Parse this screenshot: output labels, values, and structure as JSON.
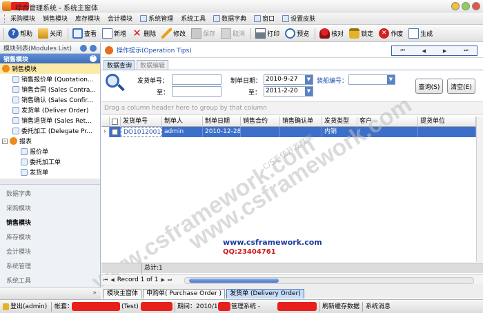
{
  "window": {
    "title": "综合管理系统 - 系统主窗体"
  },
  "menu": {
    "items": [
      {
        "label": "采购模块",
        "icon": "module-icon"
      },
      {
        "label": "销售模块",
        "icon": "module-icon"
      },
      {
        "label": "库存模块",
        "icon": "module-icon"
      },
      {
        "label": "会计模块",
        "icon": "module-icon"
      },
      {
        "label": "系统管理",
        "icon": "system-icon"
      },
      {
        "label": "系统工具",
        "icon": "tools-icon"
      },
      {
        "label": "数据字典",
        "icon": "dictionary-icon"
      },
      {
        "label": "窗口",
        "icon": "window-icon"
      },
      {
        "label": "设置皮肤",
        "icon": "skin-icon"
      }
    ]
  },
  "toolbar": {
    "help": "帮助",
    "close": "关闭",
    "view": "查看",
    "new": "新增",
    "delete": "删除",
    "edit": "修改",
    "save": "保存",
    "cancel": "取消",
    "print": "打印",
    "preview": "预览",
    "check": "核对",
    "lock": "锁定",
    "void": "作废",
    "generate": "生成"
  },
  "left_panel": {
    "header": "模块列表(Modules List)",
    "group_title": "销售模块",
    "tree": {
      "root": "销售模块",
      "items": [
        "销售报价单 (Quotation...",
        "销售合同 (Sales Contra...",
        "销售确认 (Sales Confir...",
        "发货单 (Deliver Order)",
        "销售退货单 (Sales Ret...",
        "委托加工 (Delegate Pr..."
      ],
      "report_group": "报表",
      "report_items": [
        "报价单",
        "委托加工单",
        "发货单"
      ]
    },
    "nav": {
      "items": [
        "数据字典",
        "采购模块",
        "销售模块",
        "库存模块",
        "会计模块",
        "系统管理",
        "系统工具"
      ],
      "active": "销售模块"
    },
    "bottom_arrow": "»"
  },
  "main": {
    "tips_label": "操作提示(Operation Tips)",
    "pager": {
      "first": "⏮",
      "prev": "◀",
      "next": "▶",
      "last": "⏭"
    },
    "tabs": {
      "query": "数据查询",
      "edit": "数据编辑"
    },
    "search": {
      "doc_no_label": "发货单号：",
      "to_label_1": "至：",
      "date_label": "制单日期：",
      "date_from": "2010-9-27",
      "to_label_2": "至：",
      "date_to": "2011-2-20",
      "ship_no_label": "装船编号：",
      "ship_no_value": "",
      "query_button": "查询(S)",
      "clear_button": "清空(E)"
    },
    "group_hint": "Drag a column header here to group by that column",
    "grid": {
      "columns": [
        "发货单号",
        "制单人",
        "制单日期",
        "销售合约",
        "销售确认单",
        "发货类型",
        "客户",
        "提货单位"
      ],
      "rows": [
        {
          "doc_no": "DO1012001",
          "creator": "admin",
          "date": "2010-12-28",
          "contract": "",
          "confirm": "",
          "type": "内销",
          "customer": "",
          "pickup": ""
        }
      ],
      "footer": "总计:1"
    },
    "watermark": {
      "url": "www.csframework.com",
      "qq": "QQ:23404761",
      "big_text": "www.csframework.com",
      "small_text": "C/S系统开发框架"
    },
    "record_nav": {
      "label": "Record 1 of 1",
      "first": "⏮",
      "prev": "◀",
      "next": "▶",
      "last": "⏭"
    },
    "doc_tabs": [
      "模块主窗体",
      "申购单( Purchase Order )",
      "发货单 (Delivery Order)"
    ],
    "active_doc_tab": "发货单 (Delivery Order)"
  },
  "statusbar": {
    "logout": "登出(admin)",
    "account_label": "帐套：",
    "account_suffix": "(Test)",
    "period": "期间：2010/12",
    "system_suffix": "管理系统 -",
    "refresh_cache": "刷新缓存数据",
    "system_message": "系统消息"
  },
  "colors": {
    "accent_blue": "#3c6fca",
    "selection_yellow": "#fbe9a7",
    "redaction_red": "#e8201c",
    "watermark_blue": "#1b3a9f",
    "watermark_red": "#cc1a1a"
  }
}
